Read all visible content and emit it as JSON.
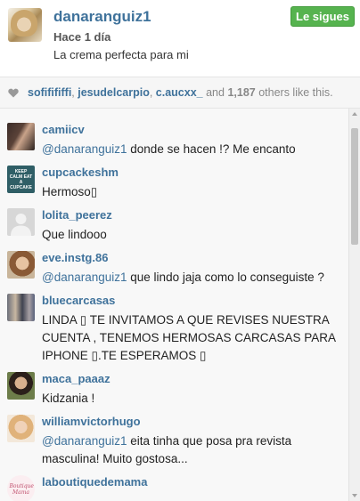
{
  "post": {
    "username": "danaranguiz1",
    "time": "Hace 1 día",
    "caption": "La crema perfecta para mi",
    "follow_label": "Le sigues"
  },
  "likes": {
    "user1": "sofifififfi",
    "user2": "jesudelcarpio",
    "user3": "c.aucxx_",
    "and_text": "and",
    "count": "1,187",
    "others_text": "others like this."
  },
  "comments": [
    {
      "user": "camiicv",
      "mention": "@danaranguiz1",
      "text": " donde se hacen !? Me encanto"
    },
    {
      "user": "cupcackeshm",
      "mention": "",
      "text": "Hermoso▯"
    },
    {
      "user": "lolita_peerez",
      "mention": "",
      "text": "Que lindooo"
    },
    {
      "user": "eve.instg.86",
      "mention": "@danaranguiz1",
      "text": " que lindo jaja como lo conseguiste ?"
    },
    {
      "user": "bluecarcasas",
      "mention": "",
      "text": "LINDA ▯ TE INVITAMOS A QUE REVISES NUESTRA CUENTA , TENEMOS HERMOSAS CARCASAS PARA IPHONE ▯.TE ESPERAMOS ▯"
    },
    {
      "user": "maca_paaaz",
      "mention": "",
      "text": "Kidzania !"
    },
    {
      "user": "williamvictorhugo",
      "mention": "@danaranguiz1",
      "text": " eita tinha que posa pra revista masculina! Muito gostosa..."
    },
    {
      "user": "laboutiquedemama",
      "mention": "",
      "text": ""
    }
  ],
  "avatar_texts": {
    "cupcake": "KEEP CALM EAT A CUPCAKE",
    "boutique": "Boutique Mama"
  },
  "colors": {
    "link": "#3f729b",
    "follow_bg": "#56b34f"
  }
}
